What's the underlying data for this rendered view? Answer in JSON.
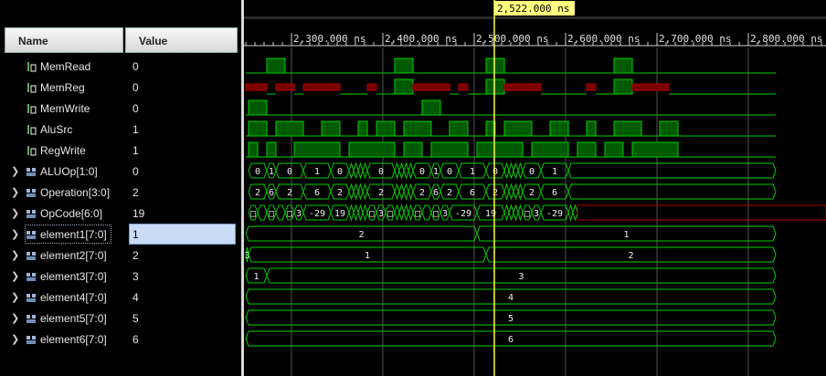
{
  "header": {
    "name_label": "Name",
    "value_label": "Value"
  },
  "cursor": {
    "time_label": "2,522.000 ns",
    "time_ns": 2522
  },
  "timeline": {
    "ticks": [
      {
        "t": 2300,
        "label": "2,300.000 ns"
      },
      {
        "t": 2400,
        "label": "2,400.000 ns"
      },
      {
        "t": 2500,
        "label": "2,500.000 ns"
      },
      {
        "t": 2600,
        "label": "2,600.000 ns"
      },
      {
        "t": 2700,
        "label": "2,700.000 ns"
      },
      {
        "t": 2800,
        "label": "2,800.000 ns"
      }
    ]
  },
  "colors": {
    "signal": "#00d000",
    "undefined": "#b00000",
    "cursor": "#ffff40",
    "bus_fill": "#003a00",
    "highlight": "#c8dcf5"
  },
  "signals": [
    {
      "name": "MemRead",
      "value": "0",
      "kind": "bit",
      "expandable": false,
      "icon": "bit-signal-icon",
      "segs": [
        [
          2250,
          2273,
          0
        ],
        [
          2273,
          2293,
          1
        ],
        [
          2293,
          2413,
          0
        ],
        [
          2413,
          2433,
          1
        ],
        [
          2433,
          2513,
          0
        ],
        [
          2513,
          2533,
          1
        ],
        [
          2533,
          2653,
          0
        ],
        [
          2653,
          2673,
          1
        ],
        [
          2673,
          2830,
          0
        ]
      ]
    },
    {
      "name": "MemReg",
      "value": "0",
      "kind": "bit",
      "expandable": false,
      "icon": "bit-signal-icon",
      "segs": [
        [
          2250,
          2273,
          "x"
        ],
        [
          2273,
          2283,
          0
        ],
        [
          2283,
          2303,
          "x"
        ],
        [
          2303,
          2313,
          0
        ],
        [
          2313,
          2353,
          "x"
        ],
        [
          2353,
          2383,
          0
        ],
        [
          2383,
          2393,
          "x"
        ],
        [
          2393,
          2413,
          0
        ],
        [
          2413,
          2433,
          1
        ],
        [
          2433,
          2473,
          "x"
        ],
        [
          2473,
          2483,
          0
        ],
        [
          2483,
          2493,
          "x"
        ],
        [
          2493,
          2513,
          0
        ],
        [
          2513,
          2533,
          1
        ],
        [
          2533,
          2573,
          "x"
        ],
        [
          2573,
          2623,
          0
        ],
        [
          2623,
          2633,
          "x"
        ],
        [
          2633,
          2653,
          0
        ],
        [
          2653,
          2673,
          1
        ],
        [
          2673,
          2713,
          "x"
        ],
        [
          2713,
          2830,
          0
        ]
      ]
    },
    {
      "name": "MemWrite",
      "value": "0",
      "kind": "bit",
      "expandable": false,
      "icon": "bit-signal-icon",
      "segs": [
        [
          2250,
          2253,
          0
        ],
        [
          2253,
          2273,
          1
        ],
        [
          2273,
          2443,
          0
        ],
        [
          2443,
          2463,
          1
        ],
        [
          2463,
          2830,
          0
        ]
      ]
    },
    {
      "name": "AluSrc",
      "value": "1",
      "kind": "bit",
      "expandable": false,
      "icon": "bit-signal-icon",
      "segs": [
        [
          2250,
          2253,
          0
        ],
        [
          2253,
          2273,
          1
        ],
        [
          2273,
          2283,
          0
        ],
        [
          2283,
          2313,
          1
        ],
        [
          2313,
          2333,
          0
        ],
        [
          2333,
          2353,
          1
        ],
        [
          2353,
          2373,
          0
        ],
        [
          2373,
          2383,
          1
        ],
        [
          2383,
          2393,
          0
        ],
        [
          2393,
          2413,
          1
        ],
        [
          2413,
          2423,
          0
        ],
        [
          2423,
          2453,
          1
        ],
        [
          2453,
          2473,
          0
        ],
        [
          2473,
          2493,
          1
        ],
        [
          2493,
          2513,
          0
        ],
        [
          2513,
          2523,
          1
        ],
        [
          2523,
          2533,
          0
        ],
        [
          2533,
          2563,
          1
        ],
        [
          2563,
          2583,
          0
        ],
        [
          2583,
          2603,
          1
        ],
        [
          2603,
          2623,
          0
        ],
        [
          2623,
          2633,
          1
        ],
        [
          2633,
          2653,
          0
        ],
        [
          2653,
          2683,
          1
        ],
        [
          2683,
          2703,
          0
        ],
        [
          2703,
          2723,
          1
        ],
        [
          2723,
          2830,
          0
        ]
      ]
    },
    {
      "name": "RegWrite",
      "value": "1",
      "kind": "bit",
      "expandable": false,
      "icon": "bit-signal-icon",
      "segs": [
        [
          2250,
          2253,
          0
        ],
        [
          2253,
          2263,
          1
        ],
        [
          2263,
          2273,
          0
        ],
        [
          2273,
          2283,
          1
        ],
        [
          2283,
          2303,
          0
        ],
        [
          2303,
          2353,
          1
        ],
        [
          2353,
          2363,
          0
        ],
        [
          2363,
          2413,
          1
        ],
        [
          2413,
          2423,
          0
        ],
        [
          2423,
          2443,
          1
        ],
        [
          2443,
          2453,
          0
        ],
        [
          2453,
          2493,
          1
        ],
        [
          2493,
          2503,
          0
        ],
        [
          2503,
          2553,
          1
        ],
        [
          2553,
          2563,
          0
        ],
        [
          2563,
          2603,
          1
        ],
        [
          2603,
          2613,
          0
        ],
        [
          2613,
          2633,
          1
        ],
        [
          2633,
          2643,
          0
        ],
        [
          2643,
          2663,
          1
        ],
        [
          2663,
          2673,
          0
        ],
        [
          2673,
          2723,
          1
        ],
        [
          2723,
          2830,
          0
        ]
      ]
    },
    {
      "name": "ALUOp[1:0]",
      "value": "0",
      "kind": "bus",
      "expandable": true,
      "icon": "bus-signal-icon",
      "segs": [
        [
          2253,
          2273,
          "0"
        ],
        [
          2273,
          2283,
          "1"
        ],
        [
          2283,
          2313,
          "0"
        ],
        [
          2313,
          2343,
          "1"
        ],
        [
          2343,
          2363,
          "0"
        ],
        [
          2363,
          2368,
          ""
        ],
        [
          2368,
          2373,
          ""
        ],
        [
          2373,
          2378,
          ""
        ],
        [
          2378,
          2383,
          ""
        ],
        [
          2383,
          2413,
          "0"
        ],
        [
          2413,
          2418,
          ""
        ],
        [
          2418,
          2423,
          ""
        ],
        [
          2423,
          2428,
          ""
        ],
        [
          2428,
          2433,
          ""
        ],
        [
          2433,
          2453,
          "0"
        ],
        [
          2453,
          2463,
          "1"
        ],
        [
          2463,
          2483,
          "0"
        ],
        [
          2483,
          2513,
          "1"
        ],
        [
          2513,
          2533,
          "0"
        ],
        [
          2533,
          2538,
          ""
        ],
        [
          2538,
          2543,
          ""
        ],
        [
          2543,
          2548,
          ""
        ],
        [
          2548,
          2553,
          ""
        ],
        [
          2553,
          2573,
          "0"
        ],
        [
          2573,
          2603,
          "1"
        ],
        [
          2603,
          2830,
          ""
        ]
      ]
    },
    {
      "name": "Operation[3:0]",
      "value": "2",
      "kind": "bus",
      "expandable": true,
      "icon": "bus-signal-icon",
      "segs": [
        [
          2253,
          2273,
          "2"
        ],
        [
          2273,
          2283,
          "6"
        ],
        [
          2283,
          2313,
          "2"
        ],
        [
          2313,
          2343,
          "6"
        ],
        [
          2343,
          2363,
          "2"
        ],
        [
          2363,
          2368,
          ""
        ],
        [
          2368,
          2373,
          ""
        ],
        [
          2373,
          2378,
          ""
        ],
        [
          2378,
          2383,
          ""
        ],
        [
          2383,
          2413,
          "2"
        ],
        [
          2413,
          2418,
          ""
        ],
        [
          2418,
          2423,
          ""
        ],
        [
          2423,
          2428,
          ""
        ],
        [
          2428,
          2433,
          ""
        ],
        [
          2433,
          2453,
          "2"
        ],
        [
          2453,
          2463,
          "6"
        ],
        [
          2463,
          2483,
          "2"
        ],
        [
          2483,
          2513,
          "6"
        ],
        [
          2513,
          2533,
          "2"
        ],
        [
          2533,
          2538,
          ""
        ],
        [
          2538,
          2543,
          ""
        ],
        [
          2543,
          2548,
          ""
        ],
        [
          2548,
          2553,
          ""
        ],
        [
          2553,
          2573,
          "2"
        ],
        [
          2573,
          2603,
          "6"
        ],
        [
          2603,
          2830,
          ""
        ]
      ]
    },
    {
      "name": "OpCode[6:0]",
      "value": "19",
      "kind": "bus",
      "expandable": true,
      "icon": "bus-signal-icon",
      "segs": [
        [
          2253,
          2263,
          "□"
        ],
        [
          2263,
          2273,
          ""
        ],
        [
          2273,
          2283,
          "□"
        ],
        [
          2283,
          2293,
          ""
        ],
        [
          2293,
          2303,
          "□"
        ],
        [
          2303,
          2313,
          "3"
        ],
        [
          2313,
          2343,
          "-29"
        ],
        [
          2343,
          2363,
          "19"
        ],
        [
          2363,
          2368,
          ""
        ],
        [
          2368,
          2373,
          ""
        ],
        [
          2373,
          2378,
          ""
        ],
        [
          2378,
          2383,
          ""
        ],
        [
          2383,
          2393,
          "□"
        ],
        [
          2393,
          2403,
          "3"
        ],
        [
          2403,
          2413,
          "□"
        ],
        [
          2413,
          2418,
          ""
        ],
        [
          2418,
          2423,
          ""
        ],
        [
          2423,
          2428,
          ""
        ],
        [
          2428,
          2433,
          ""
        ],
        [
          2433,
          2443,
          "□"
        ],
        [
          2443,
          2453,
          ""
        ],
        [
          2453,
          2463,
          "□"
        ],
        [
          2463,
          2473,
          "3"
        ],
        [
          2473,
          2503,
          "-29"
        ],
        [
          2503,
          2533,
          "19"
        ],
        [
          2533,
          2538,
          ""
        ],
        [
          2538,
          2543,
          ""
        ],
        [
          2543,
          2548,
          ""
        ],
        [
          2548,
          2553,
          ""
        ],
        [
          2553,
          2563,
          "□"
        ],
        [
          2563,
          2573,
          "3"
        ],
        [
          2573,
          2603,
          "-29"
        ],
        [
          2603,
          2608,
          ""
        ],
        [
          2608,
          2613,
          ""
        ]
      ],
      "undefined_after": 2613
    },
    {
      "name": "element1[7:0]",
      "value": "1",
      "kind": "bus",
      "expandable": true,
      "icon": "bus-signal-icon",
      "selected": true,
      "segs": [
        [
          2250,
          2503,
          "2"
        ],
        [
          2503,
          2830,
          "1"
        ]
      ]
    },
    {
      "name": "element2[7:0]",
      "value": "2",
      "kind": "bus",
      "expandable": true,
      "icon": "bus-signal-icon",
      "segs": [
        [
          2250,
          2253,
          "3"
        ],
        [
          2253,
          2513,
          "1"
        ],
        [
          2513,
          2830,
          "2"
        ]
      ]
    },
    {
      "name": "element3[7:0]",
      "value": "3",
      "kind": "bus",
      "expandable": true,
      "icon": "bus-signal-icon",
      "segs": [
        [
          2250,
          2273,
          "1"
        ],
        [
          2273,
          2830,
          "3"
        ]
      ]
    },
    {
      "name": "element4[7:0]",
      "value": "4",
      "kind": "bus",
      "expandable": true,
      "icon": "bus-signal-icon",
      "segs": [
        [
          2250,
          2830,
          "4"
        ]
      ]
    },
    {
      "name": "element5[7:0]",
      "value": "5",
      "kind": "bus",
      "expandable": true,
      "icon": "bus-signal-icon",
      "segs": [
        [
          2250,
          2830,
          "5"
        ]
      ]
    },
    {
      "name": "element6[7:0]",
      "value": "6",
      "kind": "bus",
      "expandable": true,
      "icon": "bus-signal-icon",
      "segs": [
        [
          2250,
          2830,
          "6"
        ]
      ]
    }
  ]
}
